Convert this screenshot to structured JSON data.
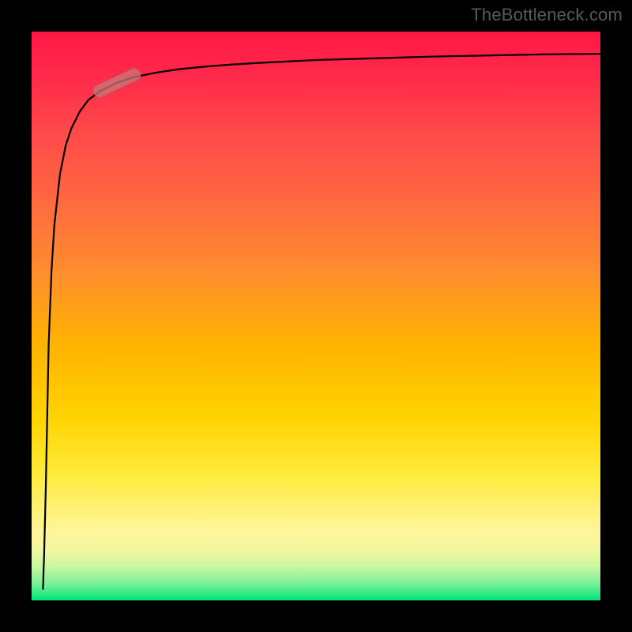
{
  "watermark": "TheBottleneck.com",
  "colors": {
    "frame": "#000000",
    "curve": "#000000",
    "marker": "rgba(200,120,120,0.75)"
  },
  "chart_data": {
    "type": "line",
    "title": "",
    "xlabel": "",
    "ylabel": "",
    "xlim": [
      0,
      100
    ],
    "ylim": [
      0,
      100
    ],
    "grid": false,
    "legend_position": "none",
    "series": [
      {
        "name": "curve",
        "x": [
          2.0,
          2.2,
          2.5,
          2.8,
          3.0,
          3.5,
          4.0,
          5.0,
          6.0,
          7.0,
          8.5,
          10,
          12,
          15,
          18,
          22,
          26,
          30,
          35,
          40,
          50,
          60,
          70,
          80,
          90,
          100
        ],
        "y": [
          2,
          8,
          20,
          35,
          45,
          58,
          66,
          75,
          80,
          83,
          86,
          88,
          89.5,
          91,
          92,
          92.8,
          93.4,
          93.8,
          94.2,
          94.5,
          95,
          95.3,
          95.6,
          95.8,
          96,
          96.1
        ]
      }
    ],
    "annotations": [
      {
        "name": "highlight-segment",
        "x": 15,
        "y": 91,
        "angle_deg": -25
      }
    ]
  }
}
